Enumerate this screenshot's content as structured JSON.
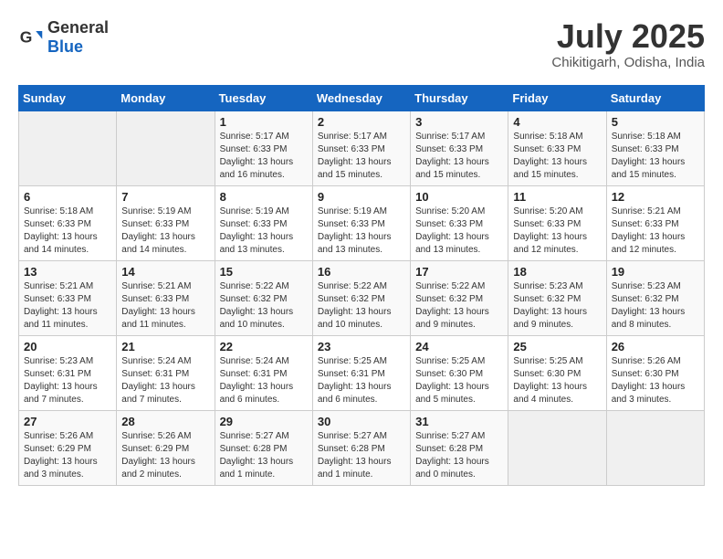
{
  "header": {
    "logo_general": "General",
    "logo_blue": "Blue",
    "month_title": "July 2025",
    "location": "Chikitigarh, Odisha, India"
  },
  "days_of_week": [
    "Sunday",
    "Monday",
    "Tuesday",
    "Wednesday",
    "Thursday",
    "Friday",
    "Saturday"
  ],
  "weeks": [
    [
      {
        "day": "",
        "info": ""
      },
      {
        "day": "",
        "info": ""
      },
      {
        "day": "1",
        "sunrise": "Sunrise: 5:17 AM",
        "sunset": "Sunset: 6:33 PM",
        "daylight": "Daylight: 13 hours and 16 minutes."
      },
      {
        "day": "2",
        "sunrise": "Sunrise: 5:17 AM",
        "sunset": "Sunset: 6:33 PM",
        "daylight": "Daylight: 13 hours and 15 minutes."
      },
      {
        "day": "3",
        "sunrise": "Sunrise: 5:17 AM",
        "sunset": "Sunset: 6:33 PM",
        "daylight": "Daylight: 13 hours and 15 minutes."
      },
      {
        "day": "4",
        "sunrise": "Sunrise: 5:18 AM",
        "sunset": "Sunset: 6:33 PM",
        "daylight": "Daylight: 13 hours and 15 minutes."
      },
      {
        "day": "5",
        "sunrise": "Sunrise: 5:18 AM",
        "sunset": "Sunset: 6:33 PM",
        "daylight": "Daylight: 13 hours and 15 minutes."
      }
    ],
    [
      {
        "day": "6",
        "sunrise": "Sunrise: 5:18 AM",
        "sunset": "Sunset: 6:33 PM",
        "daylight": "Daylight: 13 hours and 14 minutes."
      },
      {
        "day": "7",
        "sunrise": "Sunrise: 5:19 AM",
        "sunset": "Sunset: 6:33 PM",
        "daylight": "Daylight: 13 hours and 14 minutes."
      },
      {
        "day": "8",
        "sunrise": "Sunrise: 5:19 AM",
        "sunset": "Sunset: 6:33 PM",
        "daylight": "Daylight: 13 hours and 13 minutes."
      },
      {
        "day": "9",
        "sunrise": "Sunrise: 5:19 AM",
        "sunset": "Sunset: 6:33 PM",
        "daylight": "Daylight: 13 hours and 13 minutes."
      },
      {
        "day": "10",
        "sunrise": "Sunrise: 5:20 AM",
        "sunset": "Sunset: 6:33 PM",
        "daylight": "Daylight: 13 hours and 13 minutes."
      },
      {
        "day": "11",
        "sunrise": "Sunrise: 5:20 AM",
        "sunset": "Sunset: 6:33 PM",
        "daylight": "Daylight: 13 hours and 12 minutes."
      },
      {
        "day": "12",
        "sunrise": "Sunrise: 5:21 AM",
        "sunset": "Sunset: 6:33 PM",
        "daylight": "Daylight: 13 hours and 12 minutes."
      }
    ],
    [
      {
        "day": "13",
        "sunrise": "Sunrise: 5:21 AM",
        "sunset": "Sunset: 6:33 PM",
        "daylight": "Daylight: 13 hours and 11 minutes."
      },
      {
        "day": "14",
        "sunrise": "Sunrise: 5:21 AM",
        "sunset": "Sunset: 6:33 PM",
        "daylight": "Daylight: 13 hours and 11 minutes."
      },
      {
        "day": "15",
        "sunrise": "Sunrise: 5:22 AM",
        "sunset": "Sunset: 6:32 PM",
        "daylight": "Daylight: 13 hours and 10 minutes."
      },
      {
        "day": "16",
        "sunrise": "Sunrise: 5:22 AM",
        "sunset": "Sunset: 6:32 PM",
        "daylight": "Daylight: 13 hours and 10 minutes."
      },
      {
        "day": "17",
        "sunrise": "Sunrise: 5:22 AM",
        "sunset": "Sunset: 6:32 PM",
        "daylight": "Daylight: 13 hours and 9 minutes."
      },
      {
        "day": "18",
        "sunrise": "Sunrise: 5:23 AM",
        "sunset": "Sunset: 6:32 PM",
        "daylight": "Daylight: 13 hours and 9 minutes."
      },
      {
        "day": "19",
        "sunrise": "Sunrise: 5:23 AM",
        "sunset": "Sunset: 6:32 PM",
        "daylight": "Daylight: 13 hours and 8 minutes."
      }
    ],
    [
      {
        "day": "20",
        "sunrise": "Sunrise: 5:23 AM",
        "sunset": "Sunset: 6:31 PM",
        "daylight": "Daylight: 13 hours and 7 minutes."
      },
      {
        "day": "21",
        "sunrise": "Sunrise: 5:24 AM",
        "sunset": "Sunset: 6:31 PM",
        "daylight": "Daylight: 13 hours and 7 minutes."
      },
      {
        "day": "22",
        "sunrise": "Sunrise: 5:24 AM",
        "sunset": "Sunset: 6:31 PM",
        "daylight": "Daylight: 13 hours and 6 minutes."
      },
      {
        "day": "23",
        "sunrise": "Sunrise: 5:25 AM",
        "sunset": "Sunset: 6:31 PM",
        "daylight": "Daylight: 13 hours and 6 minutes."
      },
      {
        "day": "24",
        "sunrise": "Sunrise: 5:25 AM",
        "sunset": "Sunset: 6:30 PM",
        "daylight": "Daylight: 13 hours and 5 minutes."
      },
      {
        "day": "25",
        "sunrise": "Sunrise: 5:25 AM",
        "sunset": "Sunset: 6:30 PM",
        "daylight": "Daylight: 13 hours and 4 minutes."
      },
      {
        "day": "26",
        "sunrise": "Sunrise: 5:26 AM",
        "sunset": "Sunset: 6:30 PM",
        "daylight": "Daylight: 13 hours and 3 minutes."
      }
    ],
    [
      {
        "day": "27",
        "sunrise": "Sunrise: 5:26 AM",
        "sunset": "Sunset: 6:29 PM",
        "daylight": "Daylight: 13 hours and 3 minutes."
      },
      {
        "day": "28",
        "sunrise": "Sunrise: 5:26 AM",
        "sunset": "Sunset: 6:29 PM",
        "daylight": "Daylight: 13 hours and 2 minutes."
      },
      {
        "day": "29",
        "sunrise": "Sunrise: 5:27 AM",
        "sunset": "Sunset: 6:28 PM",
        "daylight": "Daylight: 13 hours and 1 minute."
      },
      {
        "day": "30",
        "sunrise": "Sunrise: 5:27 AM",
        "sunset": "Sunset: 6:28 PM",
        "daylight": "Daylight: 13 hours and 1 minute."
      },
      {
        "day": "31",
        "sunrise": "Sunrise: 5:27 AM",
        "sunset": "Sunset: 6:28 PM",
        "daylight": "Daylight: 13 hours and 0 minutes."
      },
      {
        "day": "",
        "info": ""
      },
      {
        "day": "",
        "info": ""
      }
    ]
  ]
}
